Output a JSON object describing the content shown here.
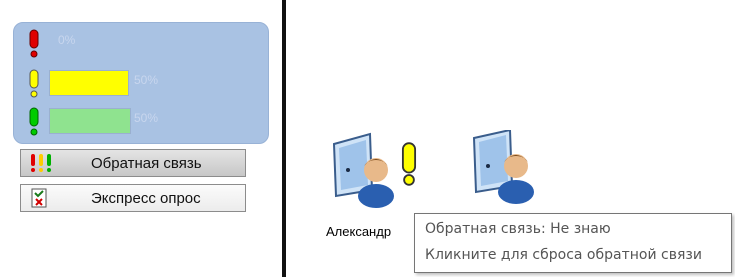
{
  "feedback_panel": {
    "rows": [
      {
        "level": "dont-know",
        "color": "#ff0000",
        "percent_label": "0%",
        "fraction": 0.0
      },
      {
        "level": "partly",
        "color": "#ffff00",
        "percent_label": "50%",
        "fraction": 0.5
      },
      {
        "level": "understood",
        "color": "#00cc00",
        "percent_label": "50%",
        "fraction": 0.5
      }
    ]
  },
  "buttons": {
    "feedback_label": "Обратная связь",
    "feedback_icon": "exclamation-triple-icon",
    "express_label": "Экспресс опрос",
    "express_icon": "quiz-icon"
  },
  "students": [
    {
      "name": "Александр",
      "feedback_color": "#ffff00"
    },
    {
      "name": "",
      "feedback_color": ""
    }
  ],
  "tooltip": {
    "line1": "Обратная связь: Не знаю",
    "line2": "Кликните для сброса обратной связи"
  }
}
